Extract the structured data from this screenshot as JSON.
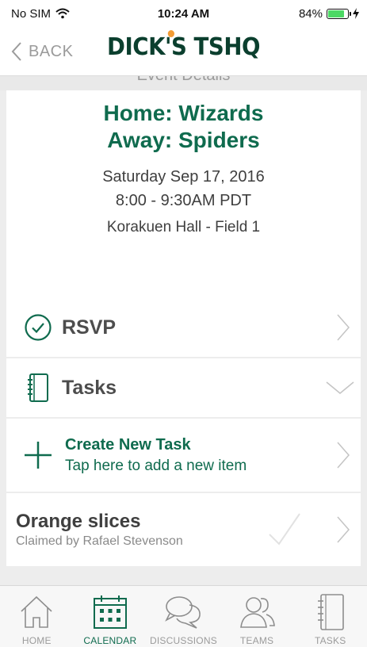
{
  "status_bar": {
    "carrier": "No SIM",
    "time": "10:24 AM",
    "battery": "84%",
    "battery_level": 0.84
  },
  "nav": {
    "back_label": "BACK",
    "logo_text_left": "DICK",
    "logo_text_right": "'S TSHQ"
  },
  "peek_header": "Event Details",
  "event": {
    "home": "Home: Wizards",
    "away": "Away: Spiders",
    "date": "Saturday Sep 17, 2016",
    "time": "8:00 - 9:30AM PDT",
    "location": "Korakuen Hall - Field 1"
  },
  "rsvp": {
    "label": "RSVP"
  },
  "tasks": {
    "label": "Tasks"
  },
  "create_task": {
    "title": "Create New Task",
    "subtitle": "Tap here to add a new item"
  },
  "task_item": {
    "name": "Orange slices",
    "claimed_by": "Claimed by Rafael Stevenson"
  },
  "tab_bar": {
    "home": "HOME",
    "calendar": "CALENDAR",
    "discussions": "DISCUSSIONS",
    "teams": "TEAMS",
    "tasks": "TASKS"
  },
  "colors": {
    "accent": "#0f6b4e",
    "battery": "#4cd964",
    "logo": "#0b3f2e"
  }
}
